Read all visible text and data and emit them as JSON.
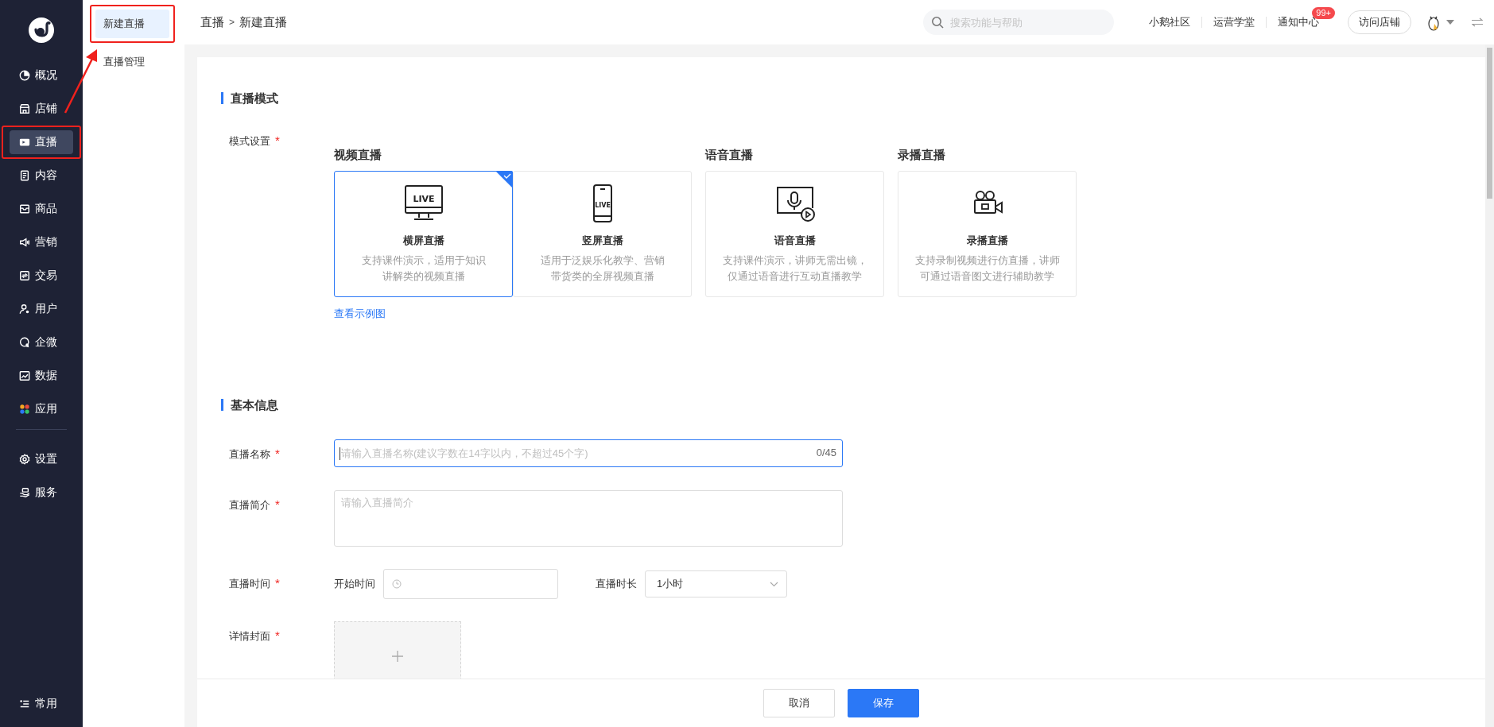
{
  "sidebar": {
    "items": [
      {
        "label": "概况",
        "selected": false,
        "highlighted": false
      },
      {
        "label": "店铺",
        "selected": false,
        "highlighted": false
      },
      {
        "label": "直播",
        "selected": true,
        "highlighted": true
      },
      {
        "label": "内容",
        "selected": false,
        "highlighted": false
      },
      {
        "label": "商品",
        "selected": false,
        "highlighted": false
      },
      {
        "label": "营销",
        "selected": false,
        "highlighted": false
      },
      {
        "label": "交易",
        "selected": false,
        "highlighted": false
      },
      {
        "label": "用户",
        "selected": false,
        "highlighted": false
      },
      {
        "label": "企微",
        "selected": false,
        "highlighted": false
      },
      {
        "label": "数据",
        "selected": false,
        "highlighted": false
      },
      {
        "label": "应用",
        "selected": false,
        "highlighted": false
      }
    ],
    "bottom_items": [
      {
        "label": "设置"
      },
      {
        "label": "服务"
      }
    ],
    "footer_item": {
      "label": "常用"
    }
  },
  "submenu": {
    "items": [
      {
        "label": "新建直播",
        "selected": true,
        "highlighted": true
      },
      {
        "label": "直播管理",
        "selected": false,
        "highlighted": false
      }
    ]
  },
  "callout_arrow": true,
  "header": {
    "breadcrumb": [
      "直播",
      "新建直播"
    ],
    "breadcrumb_separator": ">",
    "search": {
      "placeholder": "搜索功能与帮助"
    },
    "links": [
      {
        "label": "小鹅社区"
      },
      {
        "label": "运营学堂"
      },
      {
        "label": "通知中心",
        "badge": "99+"
      }
    ],
    "visit_button": "访问店铺"
  },
  "mode_section": {
    "title": "直播模式",
    "field_label": "模式设置",
    "required_mark": "*",
    "groups": [
      {
        "title": "视频直播",
        "options": [
          {
            "title": "横屏直播",
            "description": [
              "支持课件演示，适用于知识",
              "讲解类的视频直播"
            ],
            "icon_text": "LIVE",
            "selected": true
          },
          {
            "title": "竖屏直播",
            "description": [
              "适用于泛娱乐化教学、营销",
              "带货类的全屏视频直播"
            ],
            "icon_text": "LIVE",
            "selected": false
          }
        ]
      },
      {
        "title": "语音直播",
        "options": [
          {
            "title": "语音直播",
            "description": [
              "支持课件演示，讲师无需出镜，",
              "仅通过语音进行互动直播教学"
            ],
            "selected": false
          }
        ]
      },
      {
        "title": "录播直播",
        "options": [
          {
            "title": "录播直播",
            "description": [
              "支持录制视频进行仿直播，讲师",
              "可通过语音图文进行辅助教学"
            ],
            "selected": false
          }
        ]
      }
    ],
    "example_link": "查看示例图"
  },
  "info_section": {
    "title": "基本信息",
    "fields": [
      {
        "kind": "text",
        "label": "直播名称",
        "required_mark": "*",
        "placeholder": "请输入直播名称(建议字数在14字以内，不超过45个字)",
        "counter": "0/45",
        "focused": true
      },
      {
        "kind": "textarea",
        "label": "直播简介",
        "required_mark": "*",
        "placeholder": "请输入直播简介",
        "focused": false
      },
      {
        "kind": "time",
        "label": "直播时间",
        "required_mark": "*",
        "start_label": "开始时间",
        "duration_label": "直播时长",
        "duration_value": "1小时"
      },
      {
        "kind": "upload",
        "label": "详情封面",
        "required_mark": "*"
      }
    ]
  },
  "footer": {
    "buttons": [
      {
        "label": "取消",
        "kind": "secondary"
      },
      {
        "label": "保存",
        "kind": "primary"
      }
    ]
  }
}
